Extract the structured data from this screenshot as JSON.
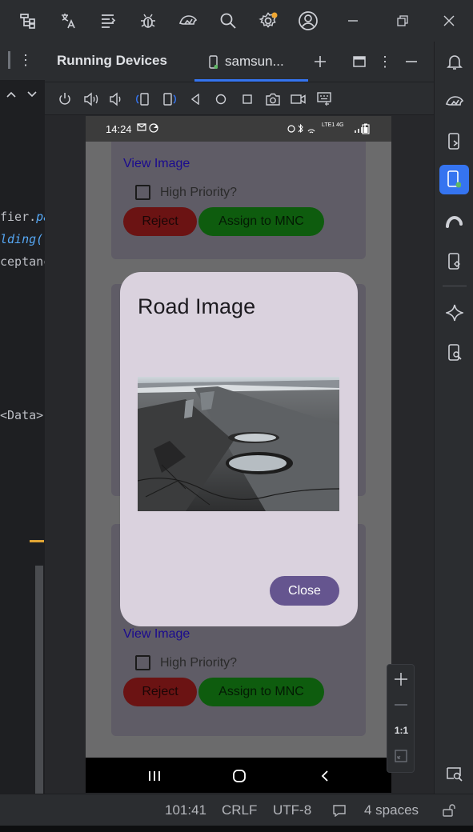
{
  "toolwindow": {
    "title": "Running Devices",
    "device_tab": "samsun..."
  },
  "editor": {
    "lines": [
      {
        "text": "fier.",
        "accent": "pa"
      },
      {
        "text": "",
        "accent": "lding("
      },
      {
        "text": "ceptanc",
        "accent": ""
      },
      {
        "text": "<Data>",
        "accent": ""
      }
    ]
  },
  "phone": {
    "time": "14:24",
    "status_right": "LTE1 4G",
    "cards": [
      {
        "link": "View Image",
        "checkbox": "High Priority?",
        "reject": "Reject",
        "assign": "Assign to MNC"
      },
      {
        "link": "View Image",
        "checkbox": "High Priority?",
        "reject": "Reject",
        "assign": "Assign to MNC"
      }
    ]
  },
  "dialog": {
    "title": "Road Image",
    "close_label": "Close"
  },
  "zoom": {
    "ratio_label": "1:1"
  },
  "statusbar": {
    "position": "101:41",
    "line_sep": "CRLF",
    "encoding": "UTF-8",
    "indent": "4 spaces"
  },
  "colors": {
    "accent": "#3574f0",
    "dialog_bg": "#dad2de",
    "close_button": "#65558f",
    "reject_button": "#6b1313",
    "assign_button": "#0e5c0e"
  }
}
